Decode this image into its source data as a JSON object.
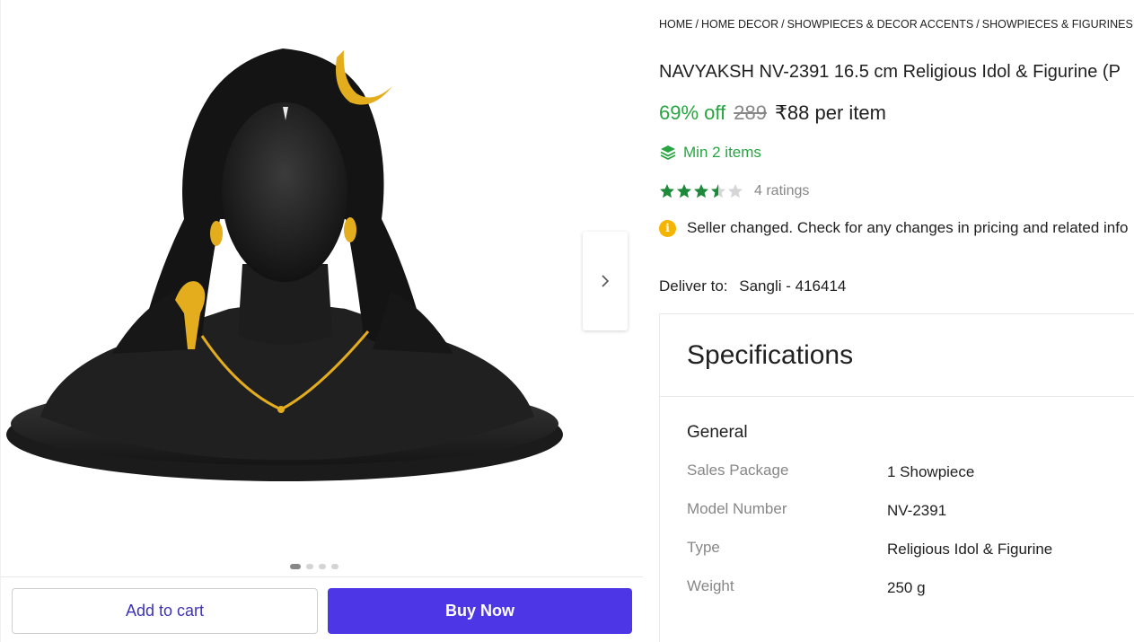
{
  "breadcrumb": [
    {
      "label": "HOME"
    },
    {
      "label": "HOME DECOR"
    },
    {
      "label": "SHOWPIECES & DECOR ACCENTS"
    },
    {
      "label": "SHOWPIECES & FIGURINES"
    }
  ],
  "breadcrumb_separator": "/",
  "product": {
    "title": "NAVYAKSH NV-2391 16.5 cm Religious Idol & Figurine (P",
    "discount": "69% off",
    "mrp": "289",
    "price": "₹88 per item",
    "min_qty": "Min 2 items",
    "rating_value": 3.5,
    "ratings_count": "4 ratings",
    "seller_notice": "Seller changed. Check for any changes in pricing and related info"
  },
  "delivery": {
    "label": "Deliver to:",
    "location": "Sangli - 416414"
  },
  "gallery": {
    "image_count": 4,
    "active_index": 0,
    "next_icon": "chevron-right-icon"
  },
  "actions": {
    "add_to_cart": "Add to cart",
    "buy_now": "Buy Now"
  },
  "specifications": {
    "title": "Specifications",
    "section": "General",
    "rows": [
      {
        "key": "Sales Package",
        "value": "1 Showpiece"
      },
      {
        "key": "Model Number",
        "value": "NV-2391"
      },
      {
        "key": "Type",
        "value": "Religious Idol & Figurine"
      },
      {
        "key": "Weight",
        "value": "250 g"
      }
    ]
  },
  "colors": {
    "discount_green": "#26a541",
    "buy_now_bg": "#4c36e6",
    "add_to_cart_text": "#3d33b8",
    "star_green": "#1c8a3a",
    "info_icon": "#f4b400"
  }
}
